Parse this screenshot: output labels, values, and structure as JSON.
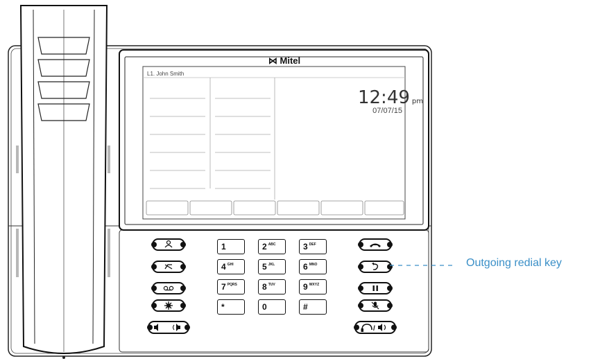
{
  "phone": {
    "brand": "Mitel",
    "screen": {
      "line_label": "L1. John Smith",
      "time": "12:49",
      "ampm": "pm",
      "date": "07/07/15"
    }
  },
  "keypad": [
    {
      "digit": "1",
      "letters": ""
    },
    {
      "digit": "2",
      "letters": "ABC"
    },
    {
      "digit": "3",
      "letters": "DEF"
    },
    {
      "digit": "4",
      "letters": "GHI"
    },
    {
      "digit": "5",
      "letters": "JKL"
    },
    {
      "digit": "6",
      "letters": "MNO"
    },
    {
      "digit": "7",
      "letters": "PQRS"
    },
    {
      "digit": "8",
      "letters": "TUV"
    },
    {
      "digit": "9",
      "letters": "WXYZ"
    },
    {
      "digit": "*",
      "letters": ""
    },
    {
      "digit": "0",
      "letters": ""
    },
    {
      "digit": "#",
      "letters": ""
    }
  ],
  "left_keys": [
    "contacts-icon",
    "call-history-icon",
    "voicemail-icon",
    "options-icon",
    "volume-icon"
  ],
  "right_keys": [
    "goodbye-icon",
    "redial-icon",
    "hold-icon",
    "mute-icon",
    "headset-speaker-icon"
  ],
  "callout": {
    "label": "Outgoing redial key",
    "color": "#3a8fc7"
  }
}
